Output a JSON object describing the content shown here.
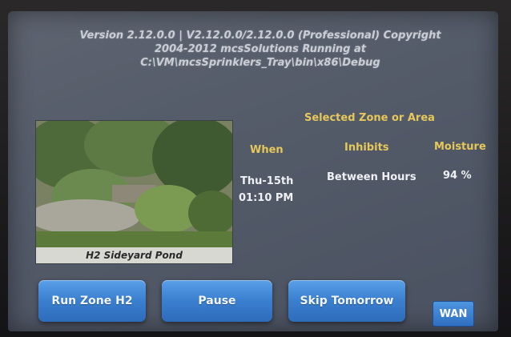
{
  "header": {
    "version_text": "Version 2.12.0.0 | V2.12.0.0/2.12.0.0 (Professional) Copyright 2004-2012 mcsSolutions Running at C:\\VM\\mcsSprinklers_Tray\\bin\\x86\\Debug"
  },
  "zone": {
    "photo_caption": "H2 Sideyard Pond",
    "selected_title": "Selected Zone or Area",
    "columns": {
      "when": "When",
      "inhibits": "Inhibits",
      "moisture": "Moisture"
    },
    "values": {
      "when_day": "Thu-15th",
      "when_time": "01:10 PM",
      "inhibits": "Between Hours",
      "moisture": "94 %"
    }
  },
  "buttons": {
    "run_zone": "Run Zone H2",
    "pause": "Pause",
    "skip_tomorrow": "Skip Tomorrow",
    "wan": "WAN"
  },
  "colors": {
    "screen_bg": "#565d6b",
    "header_gold": "#e6c85a",
    "button_blue": "#3a7fcf"
  }
}
